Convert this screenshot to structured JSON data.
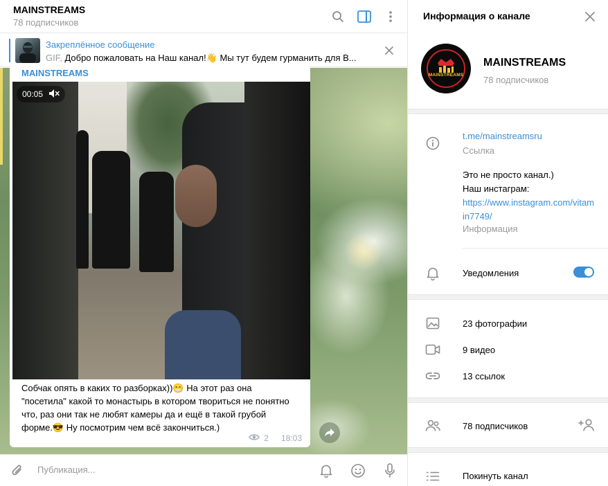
{
  "chat": {
    "title": "MAINSTREAMS",
    "subtitle": "78 подписчиков",
    "pinned": {
      "title": "Закреплённое сообщение",
      "prefix": "GIF,",
      "text": " Добро пожаловать на Наш канал!👋 Мы тут будем гурманить для В..."
    },
    "message": {
      "author": "MAINSTREAMS",
      "video_time": "00:05",
      "text": "Собчак опять в каких то разборках))😁 На этот раз она \"посетила\" какой то монастырь в котором твориться не понятно что, раз они так не любят камеры да и ещё в такой грубой форме.😎 Ну посмотрим чем всё закончиться.)",
      "views": "2",
      "time": "18:03"
    },
    "composer_placeholder": "Публикация..."
  },
  "info": {
    "title": "Информация о канале",
    "channel_name": "MAINSTREAMS",
    "channel_subs": "78 подписчиков",
    "avatar_text": "MAINSTREAMS",
    "link": "t.me/mainstreamsru",
    "link_label": "Ссылка",
    "desc_line1": "Это не просто канал.)",
    "desc_line2": "Наш инстаграм:",
    "desc_url": "https://www.instagram.com/vitamin7749/",
    "desc_label": "Информация",
    "notifications_label": "Уведомления",
    "notifications_on": true,
    "media": {
      "photos": "23 фотографии",
      "videos": "9 видео",
      "links": "13 ссылок"
    },
    "members": "78 подписчиков",
    "leave": "Покинуть канал"
  },
  "colors": {
    "accent": "#3a8fd6",
    "muted": "#999999"
  },
  "icons": [
    "search-icon",
    "sidebar-toggle-icon",
    "more-icon",
    "close-icon",
    "mute-icon",
    "eye-icon",
    "share-icon",
    "attach-icon",
    "bell-icon",
    "emoji-icon",
    "mic-icon",
    "info-icon",
    "photo-icon",
    "video-icon",
    "link-icon",
    "members-icon",
    "add-member-icon",
    "leave-icon"
  ]
}
